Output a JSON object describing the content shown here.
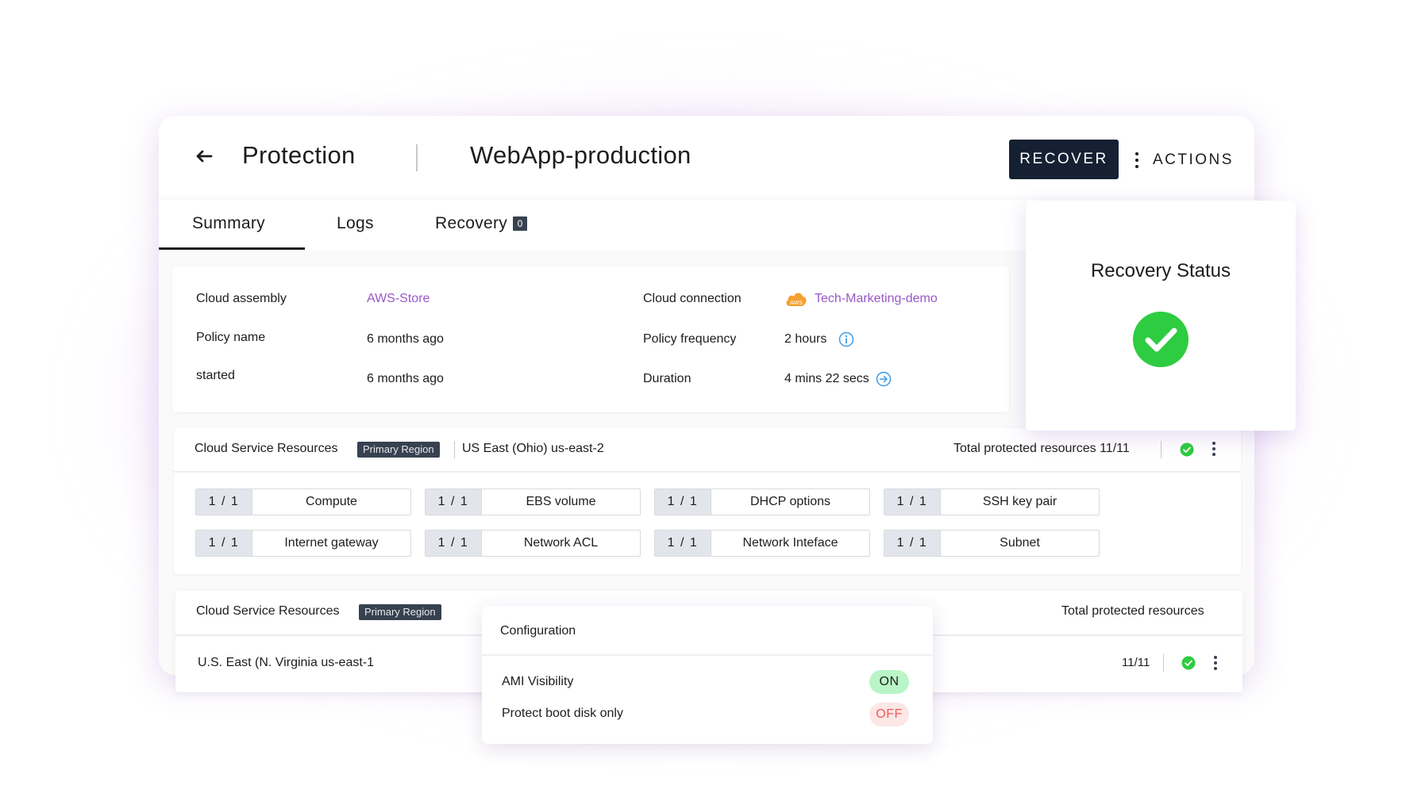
{
  "header": {
    "title": "Protection",
    "resource": "WebApp-production",
    "recover_label": "RECOVER",
    "actions_label": "ACTIONS"
  },
  "tabs": [
    {
      "label": "Summary",
      "active": true
    },
    {
      "label": "Logs"
    },
    {
      "label": "Recovery",
      "badge": "0"
    }
  ],
  "summary": {
    "cloud_assembly_label": "Cloud assembly",
    "cloud_assembly_value": "AWS-Store",
    "policy_name_label": "Policy name",
    "policy_name_value": "6 months ago",
    "started_label": "started",
    "started_value": "6 months ago",
    "cloud_connection_label": "Cloud connection",
    "cloud_connection_value": "Tech-Marketing-demo",
    "policy_frequency_label": "Policy frequency",
    "policy_frequency_value": "2 hours",
    "duration_label": "Duration",
    "duration_value": "4 mins 22 secs"
  },
  "csr1": {
    "title": "Cloud Service Resources",
    "badge": "Primary Region",
    "region": "US East (Ohio) us-east-2",
    "total": "Total protected resources 11/11",
    "chips": [
      {
        "count": "1 / 1",
        "name": "Compute"
      },
      {
        "count": "1 / 1",
        "name": "EBS volume"
      },
      {
        "count": "1 / 1",
        "name": "DHCP options"
      },
      {
        "count": "1 / 1",
        "name": "SSH key pair"
      },
      {
        "count": "1 / 1",
        "name": "Internet gateway"
      },
      {
        "count": "1 / 1",
        "name": "Network ACL"
      },
      {
        "count": "1 / 1",
        "name": "Network Inteface"
      },
      {
        "count": "1 / 1",
        "name": "Subnet"
      }
    ]
  },
  "csr2": {
    "title": "Cloud Service Resources",
    "badge": "Primary Region",
    "total_label": "Total protected resources",
    "region": "U.S. East (N. Virginia us-east-1",
    "count": "11/11"
  },
  "config": {
    "title": "Configuration",
    "items": [
      {
        "label": "AMI Visibility",
        "state": "ON"
      },
      {
        "label": "Protect boot disk only",
        "state": "OFF"
      }
    ]
  },
  "status_card": {
    "title": "Recovery Status"
  },
  "colors": {
    "navy": "#152033",
    "link_purple": "#9a58c9",
    "success_green": "#2ecc40",
    "aws_orange": "#f5a030",
    "info_blue": "#3a9be8"
  },
  "icons": {
    "aws_logo_text": "AWS"
  }
}
